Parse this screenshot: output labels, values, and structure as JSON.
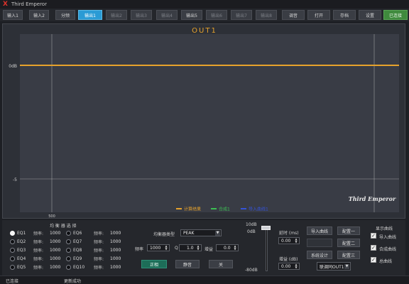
{
  "app": {
    "title": "Third Emperor",
    "logo": "X"
  },
  "toolbar": {
    "tabs": [
      {
        "label": "输入1",
        "state": "normal"
      },
      {
        "label": "输入2",
        "state": "normal"
      },
      {
        "label": "分频",
        "state": "normal"
      },
      {
        "label": "输出1",
        "state": "active"
      },
      {
        "label": "输出2",
        "state": "disabled"
      },
      {
        "label": "输出3",
        "state": "disabled"
      },
      {
        "label": "输出4",
        "state": "disabled"
      },
      {
        "label": "输出5",
        "state": "normal"
      },
      {
        "label": "输出6",
        "state": "disabled"
      },
      {
        "label": "输出7",
        "state": "disabled"
      },
      {
        "label": "输出8",
        "state": "disabled"
      },
      {
        "label": "调音",
        "state": "normal"
      },
      {
        "label": "打开",
        "state": "normal"
      },
      {
        "label": "存档",
        "state": "normal"
      },
      {
        "label": "设置",
        "state": "normal"
      }
    ],
    "status": "已连接"
  },
  "chart_data": {
    "type": "line",
    "title": "OUT1",
    "y_ticks": [
      "0dB",
      "-5"
    ],
    "x_ticks": [
      "500"
    ],
    "ylim": [
      -10,
      2
    ],
    "grid": true,
    "series": [
      {
        "name": "计算结果",
        "color": "#e6a22c",
        "y": 0
      }
    ],
    "legend": [
      {
        "name": "计算结果",
        "color": "#e6a22c"
      },
      {
        "name": "合成1",
        "color": "#3cbf53"
      },
      {
        "name": "导入曲线1",
        "color": "#3553d8"
      }
    ],
    "watermark": "Third Emperor",
    "colors": {
      "line": "#e6a22c",
      "background": "#2d3037",
      "grid": "#c8c8c8"
    }
  },
  "eq": {
    "group_title": "均 衡 器 选 择",
    "freq_label": "频率:",
    "items": [
      {
        "label": "EQ1",
        "freq": "1000",
        "selected": true
      },
      {
        "label": "EQ2",
        "freq": "1000",
        "selected": false
      },
      {
        "label": "EQ3",
        "freq": "1000",
        "selected": false
      },
      {
        "label": "EQ4",
        "freq": "1000",
        "selected": false
      },
      {
        "label": "EQ5",
        "freq": "1000",
        "selected": false
      },
      {
        "label": "EQ6",
        "freq": "1000",
        "selected": false
      },
      {
        "label": "EQ7",
        "freq": "1000",
        "selected": false
      },
      {
        "label": "EQ8",
        "freq": "1000",
        "selected": false
      },
      {
        "label": "EQ9",
        "freq": "1000",
        "selected": false
      },
      {
        "label": "EQ10",
        "freq": "1000",
        "selected": false
      }
    ]
  },
  "filter": {
    "type_label": "均衡器类型",
    "type_value": "PEAK",
    "freq_label": "频率",
    "freq_value": "1000",
    "q_label": "Q",
    "q_value": "1.0",
    "gain_label": "增益",
    "gain_value": "0.0",
    "btn_normal": "正相",
    "btn_mute": "静音",
    "btn_close": "关"
  },
  "slider": {
    "top_label": "10dB",
    "mid_label": "0dB",
    "bottom_label": "-80dB",
    "level": 1.0
  },
  "delay": {
    "label": "延时 (ms)",
    "value": "0.00"
  },
  "gain": {
    "label": "增益 (dB)",
    "value": "0.00"
  },
  "actions": {
    "import_curve": "导入曲线",
    "system_design": "系统设计",
    "config1": "配置一",
    "config2": "配置二",
    "config3": "配置三",
    "link_select": "联调同OUT1"
  },
  "display": {
    "title": "显示曲线",
    "items": [
      {
        "label": "导入曲线",
        "checked": true
      },
      {
        "label": "合成曲线",
        "checked": true
      },
      {
        "label": "总曲线",
        "checked": true
      }
    ]
  },
  "statusbar": {
    "left": "已连接",
    "right": "更新成功"
  }
}
